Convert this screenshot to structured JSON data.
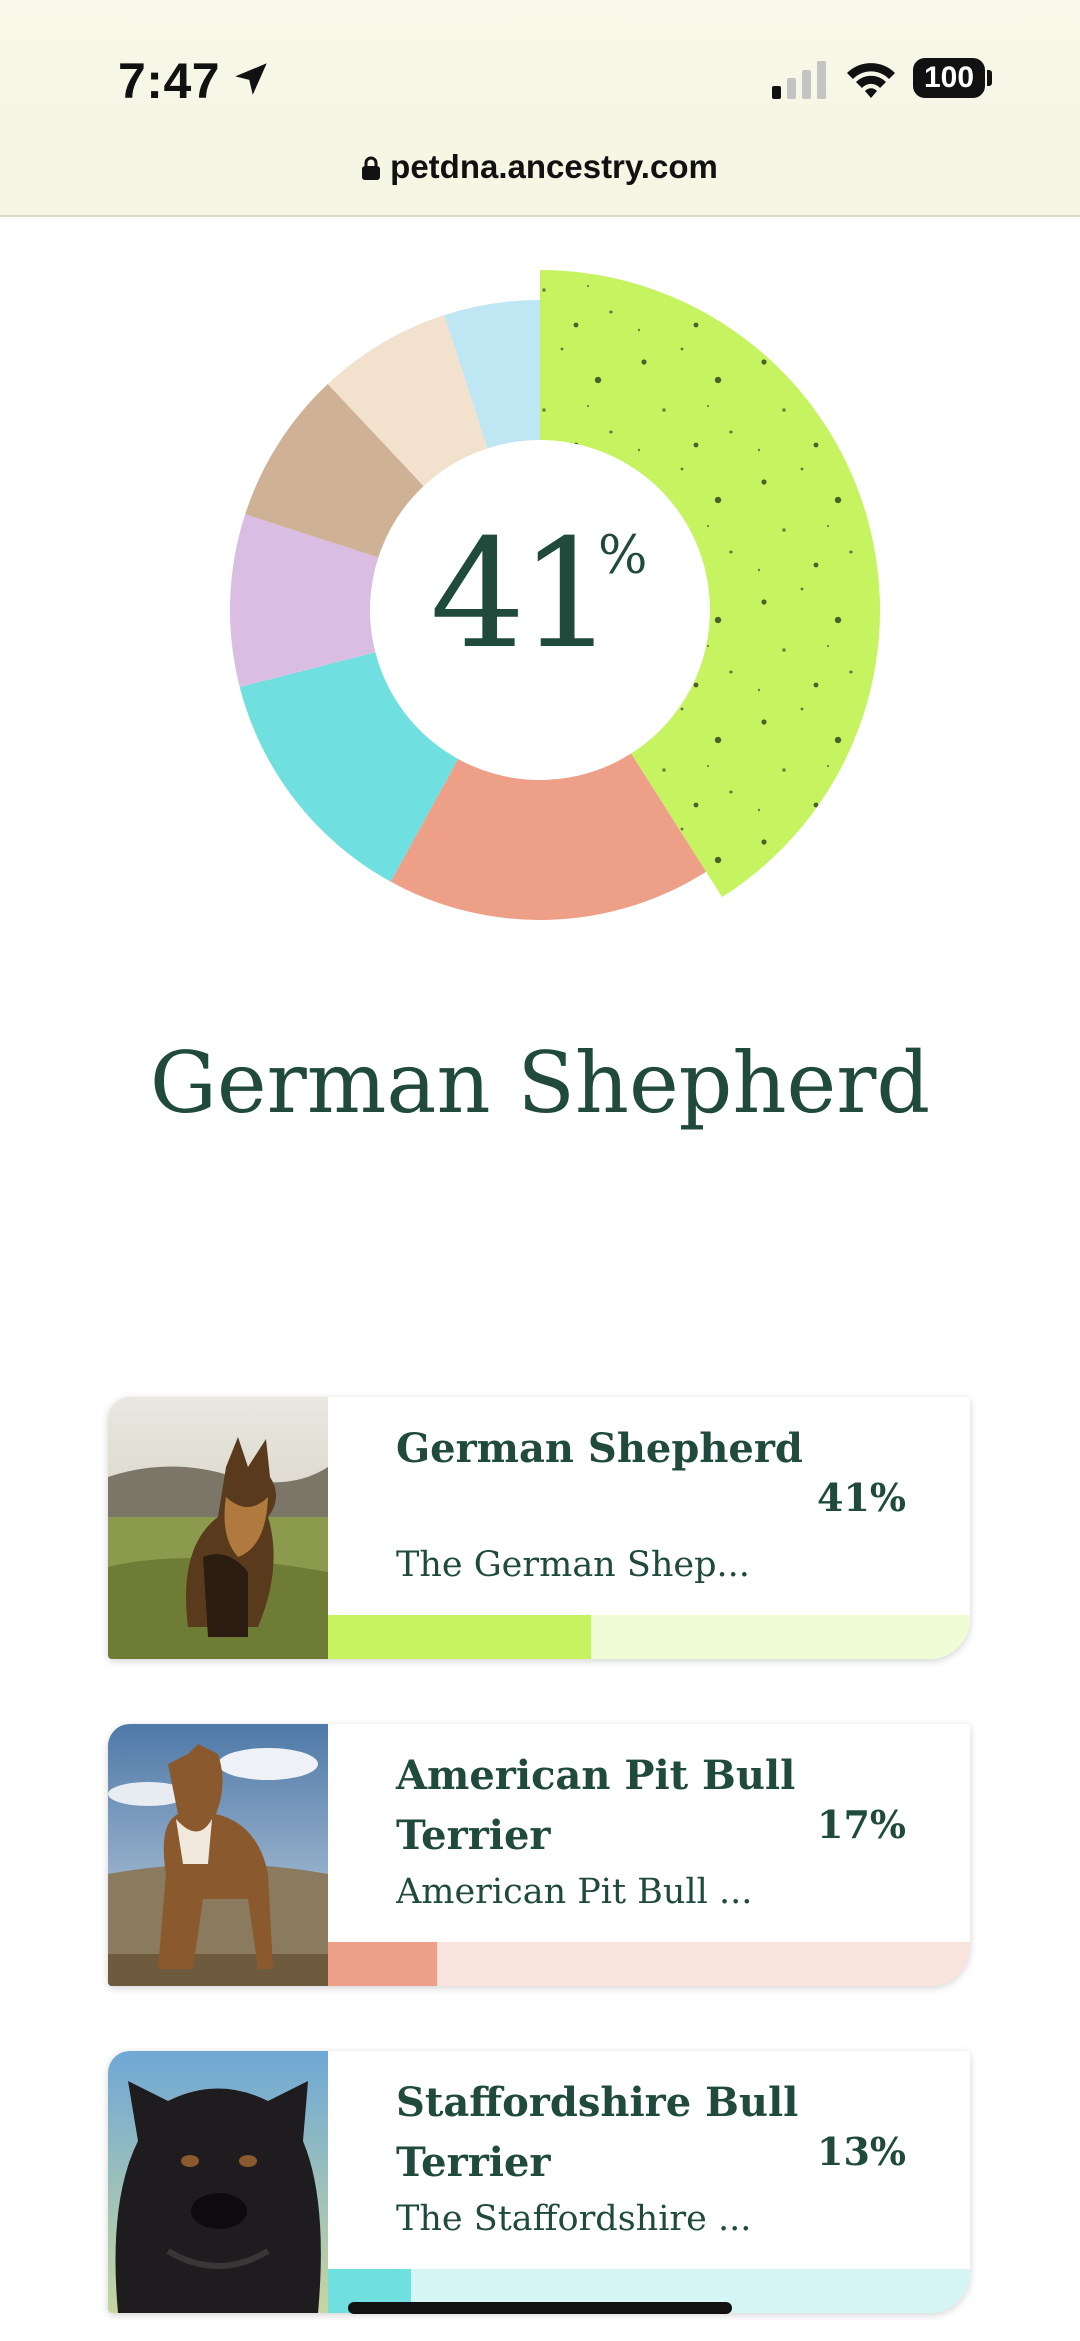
{
  "status_bar": {
    "time": "7:47",
    "battery": "100"
  },
  "browser": {
    "url": "petdna.ancestry.com"
  },
  "donut": {
    "value": "41",
    "unit": "%"
  },
  "chart_data": {
    "type": "pie",
    "values": [
      41,
      17,
      13,
      9,
      8,
      7,
      5
    ],
    "colors": [
      "#c5f460",
      "#ee9f88",
      "#6fdfdf",
      "#d9bde3",
      "#cfb195",
      "#f2e1cd",
      "#bfe6f3"
    ],
    "highlighted_index": 0
  },
  "heading": "German Shepherd",
  "breeds": [
    {
      "name": "German Shepherd",
      "percent": "41%",
      "description": "The German Shep...",
      "share": 0.41,
      "color": "#c5f460",
      "track_color": "#effcd6"
    },
    {
      "name": "American Pit Bull Terrier",
      "percent": "17%",
      "description": "American Pit Bull ...",
      "share": 0.17,
      "color": "#ee9f88",
      "track_color": "#f9e3dd"
    },
    {
      "name": "Staffordshire Bull Terrier",
      "percent": "13%",
      "description": "The Staffordshire ...",
      "share": 0.13,
      "color": "#6fdfdf",
      "track_color": "#d6f6f6"
    }
  ]
}
